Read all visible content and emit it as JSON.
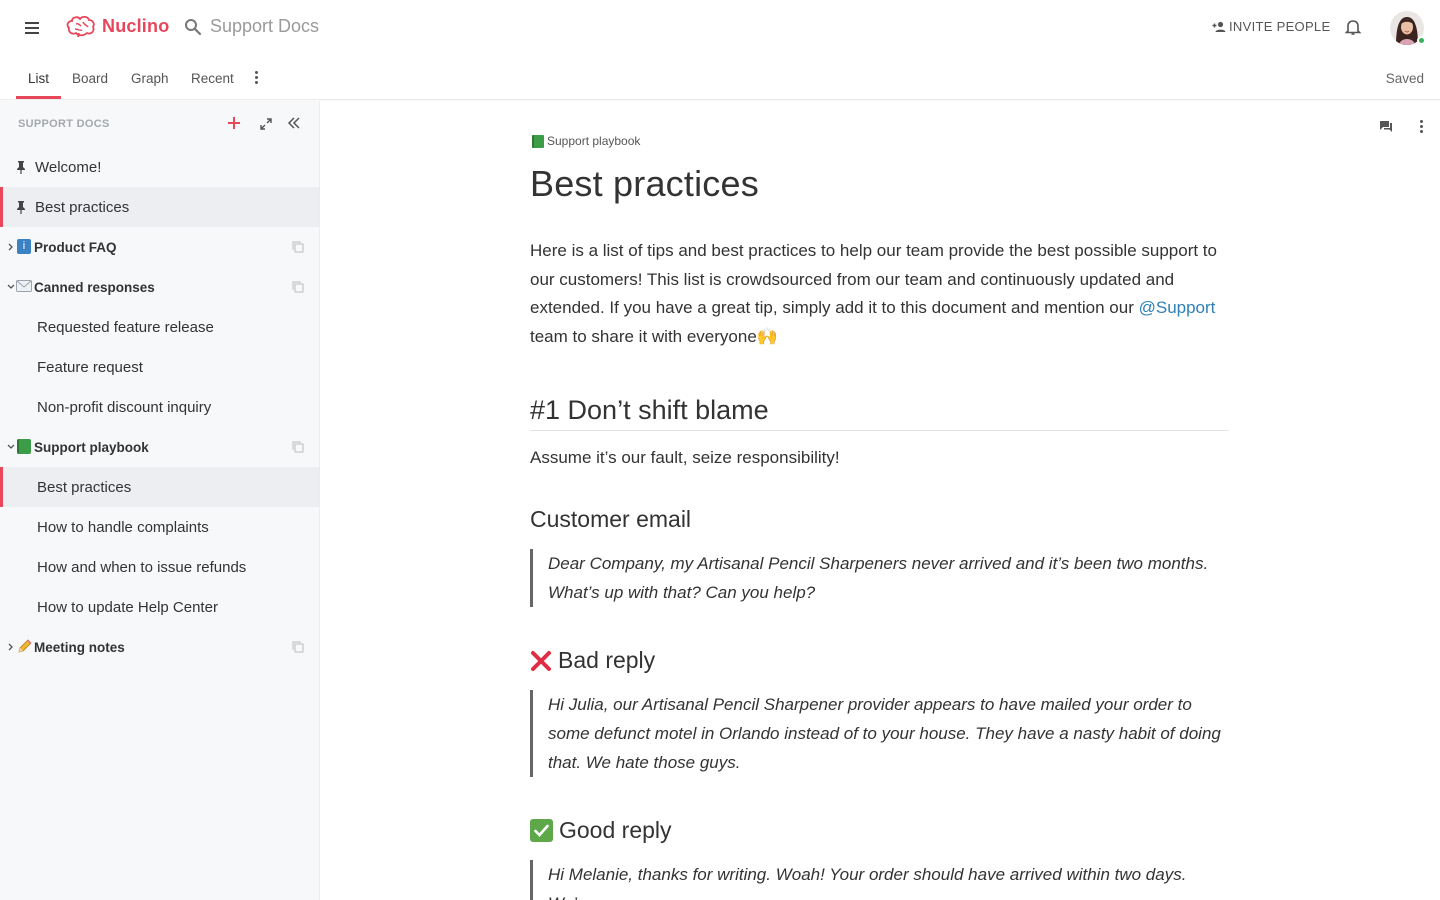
{
  "app": {
    "brand": "Nuclino",
    "brand_color": "#e8465a",
    "search_placeholder": "Support Docs",
    "invite_label": "INVITE PEOPLE",
    "status_color": "#35b35b"
  },
  "tabs": [
    {
      "label": "List",
      "active": true
    },
    {
      "label": "Board",
      "active": false
    },
    {
      "label": "Graph",
      "active": false
    },
    {
      "label": "Recent",
      "active": false
    }
  ],
  "save_status": "Saved",
  "sidebar": {
    "header": "SUPPORT DOCS",
    "pinned": [
      {
        "label": "Welcome!",
        "selected": false
      },
      {
        "label": "Best practices",
        "selected": true
      }
    ],
    "clusters": [
      {
        "icon": "info-icon",
        "label": "Product FAQ",
        "expanded": false,
        "children": []
      },
      {
        "icon": "envelope-icon",
        "label": "Canned responses",
        "expanded": true,
        "children": [
          "Requested feature release",
          "Feature request",
          "Non-profit discount inquiry"
        ]
      },
      {
        "icon": "green-book-icon",
        "label": "Support playbook",
        "expanded": true,
        "children": [
          "Best practices",
          "How to handle complaints",
          "How and when to issue refunds",
          "How to update Help Center"
        ],
        "selected_child": "Best practices"
      },
      {
        "icon": "pencil-icon",
        "label": "Meeting notes",
        "expanded": false,
        "children": []
      }
    ]
  },
  "document": {
    "breadcrumb": "Support playbook",
    "title": "Best practices",
    "intro_lines": [
      "Here is a list of tips and best practices to help our team provide the best possible support to",
      "our customers! This list is crowdsourced from our team and continuously updated and",
      "extended. If you have a great tip, simply add it to this document and mention our ",
      "team to share it with everyone"
    ],
    "mention": "@Support",
    "intro_emoji": "🙌",
    "section1_heading": "#1 Don’t shift blame",
    "section1_text": "Assume it’s our fault, seize responsibility!",
    "customer_heading": "Customer email",
    "customer_quote": [
      "Dear Company, my Artisanal Pencil Sharpeners never arrived and it’s been two months.",
      "What’s up with that? Can you help?"
    ],
    "bad_heading": "Bad reply",
    "bad_quote": [
      "Hi Julia, our Artisanal Pencil Sharpener provider appears to have mailed your order to",
      "some defunct motel in Orlando instead of to your house. They have a nasty habit of doing",
      "that. We hate those guys."
    ],
    "good_heading": "Good reply",
    "good_quote": [
      "Hi Melanie, thanks for writing. Woah! Your order should have arrived within two days. We’re"
    ]
  }
}
